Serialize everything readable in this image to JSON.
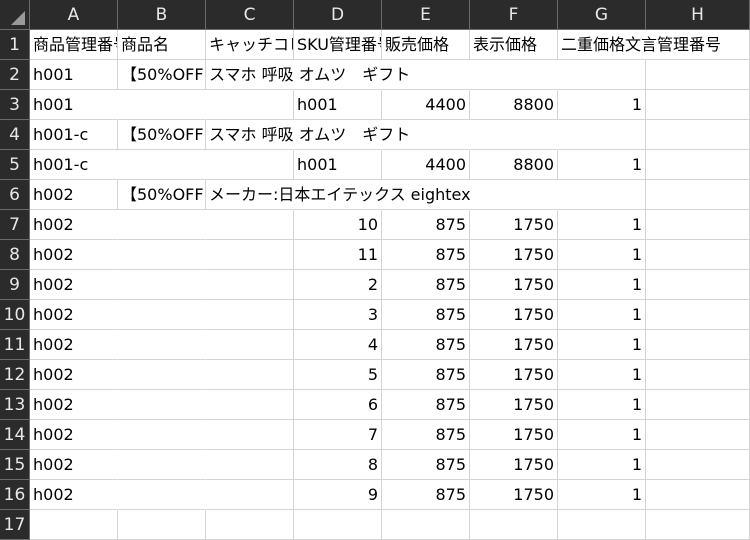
{
  "columns": [
    "A",
    "B",
    "C",
    "D",
    "E",
    "F",
    "G",
    "H"
  ],
  "row_numbers": [
    "1",
    "2",
    "3",
    "4",
    "5",
    "6",
    "7",
    "8",
    "9",
    "10",
    "11",
    "12",
    "13",
    "14",
    "15",
    "16",
    "17"
  ],
  "rows": [
    [
      "商品管理番号",
      "商品名",
      "キャッチコピー",
      "SKU管理番号",
      "販売価格",
      "表示価格",
      "二重価格文言管理番号",
      ""
    ],
    [
      "h001",
      "【50%OFF",
      "スマホ 呼吸 オムツ　ギフト",
      "",
      "",
      "",
      "",
      ""
    ],
    [
      "h001",
      "",
      "",
      "h001",
      "4400",
      "8800",
      "1",
      ""
    ],
    [
      "h001-c",
      "【50%OFF",
      "スマホ 呼吸 オムツ　ギフト",
      "",
      "",
      "",
      "",
      ""
    ],
    [
      "h001-c",
      "",
      "",
      "h001",
      "4400",
      "8800",
      "1",
      ""
    ],
    [
      "h002",
      "【50%OFF",
      "メーカー:日本エイテックス eightex",
      "",
      "",
      "",
      "",
      ""
    ],
    [
      "h002",
      "",
      "",
      "10",
      "875",
      "1750",
      "1",
      ""
    ],
    [
      "h002",
      "",
      "",
      "11",
      "875",
      "1750",
      "1",
      ""
    ],
    [
      "h002",
      "",
      "",
      "2",
      "875",
      "1750",
      "1",
      ""
    ],
    [
      "h002",
      "",
      "",
      "3",
      "875",
      "1750",
      "1",
      ""
    ],
    [
      "h002",
      "",
      "",
      "4",
      "875",
      "1750",
      "1",
      ""
    ],
    [
      "h002",
      "",
      "",
      "5",
      "875",
      "1750",
      "1",
      ""
    ],
    [
      "h002",
      "",
      "",
      "6",
      "875",
      "1750",
      "1",
      ""
    ],
    [
      "h002",
      "",
      "",
      "7",
      "875",
      "1750",
      "1",
      ""
    ],
    [
      "h002",
      "",
      "",
      "8",
      "875",
      "1750",
      "1",
      ""
    ],
    [
      "h002",
      "",
      "",
      "9",
      "875",
      "1750",
      "1",
      ""
    ],
    [
      "",
      "",
      "",
      "",
      "",
      "",
      "",
      ""
    ]
  ],
  "numeric_columns": [
    3,
    4,
    5,
    6
  ],
  "colors": {
    "header_bg": "#2b2b2b",
    "header_text": "#e8e8e8",
    "gridline": "#d4d4d4",
    "cell_bg": "#ffffff"
  }
}
